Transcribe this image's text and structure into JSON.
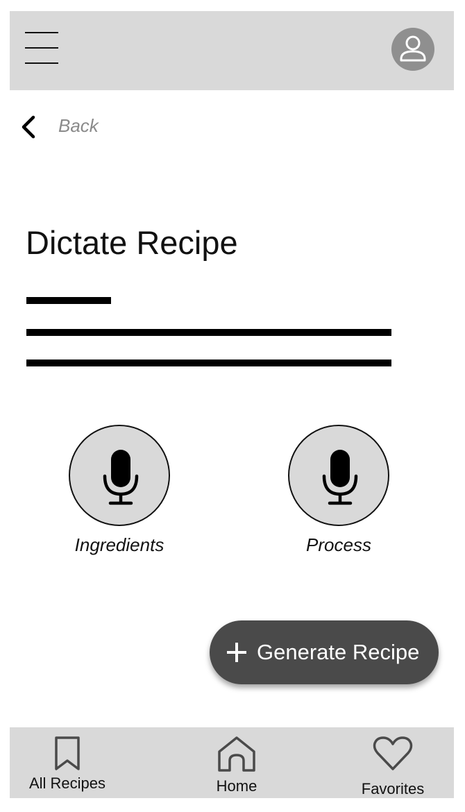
{
  "header": {
    "menu_icon": "hamburger-menu-icon",
    "avatar_icon": "user-avatar-icon"
  },
  "navigation": {
    "back_label": "Back",
    "back_icon": "chevron-left-icon"
  },
  "main": {
    "title": "Dictate Recipe",
    "dictation_buttons": [
      {
        "label": "Ingredients",
        "icon": "microphone-icon"
      },
      {
        "label": "Process",
        "icon": "microphone-icon"
      }
    ]
  },
  "fab": {
    "label": "Generate Recipe",
    "icon": "plus-icon",
    "color": "#4a4a4a"
  },
  "bottom_nav": {
    "items": [
      {
        "label": "All Recipes",
        "icon": "bookmark-icon"
      },
      {
        "label": "Home",
        "icon": "home-icon"
      },
      {
        "label": "Favorites",
        "icon": "heart-icon"
      }
    ]
  },
  "colors": {
    "bar_background": "#d9d9d9",
    "avatar_background": "#8f8f8f",
    "muted_text": "#8a8a8a"
  }
}
